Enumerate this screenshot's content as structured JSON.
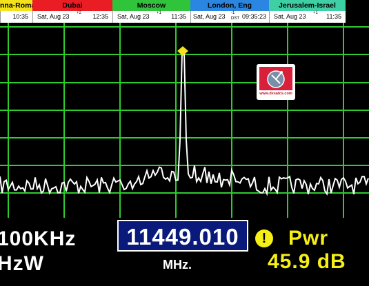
{
  "clocks": [
    {
      "tz": "nna-Roma",
      "color": "#f4e21a",
      "text_color": "#000000",
      "date": "",
      "time": "10:35",
      "offset": ""
    },
    {
      "tz": "Dubai",
      "color": "#ea1c24",
      "text_color": "#000000",
      "date": "Sat, Aug 23",
      "time": "12:35",
      "offset": "+2"
    },
    {
      "tz": "Moscow",
      "color": "#2fc43a",
      "text_color": "#000000",
      "date": "Sat, Aug 23",
      "time": "11:35",
      "offset": "+1"
    },
    {
      "tz": "London, Eng",
      "color": "#2a86e0",
      "text_color": "#000000",
      "date": "Sat, Aug 23",
      "time": "09:35:23",
      "offset": "-1",
      "dst": "DST"
    },
    {
      "tz": "Jerusalem-Israel",
      "color": "#3fcfa4",
      "text_color": "#000000",
      "date": "Sat, Aug 23",
      "time": "11:35",
      "offset": "+1"
    }
  ],
  "spectrum": {
    "grid_color": "#2ecc2e",
    "trace_color": "#ffffff",
    "marker_color": "#f6e021",
    "has_marker": true
  },
  "logo": {
    "text": "www.dxsatcs.com"
  },
  "readout": {
    "span_line1": "100KHz",
    "span_line2": "HzW",
    "frequency": "11449.010",
    "frequency_unit": "MHz.",
    "warning_symbol": "!",
    "power_label": "Pwr",
    "power_value": "45.9 dB"
  }
}
